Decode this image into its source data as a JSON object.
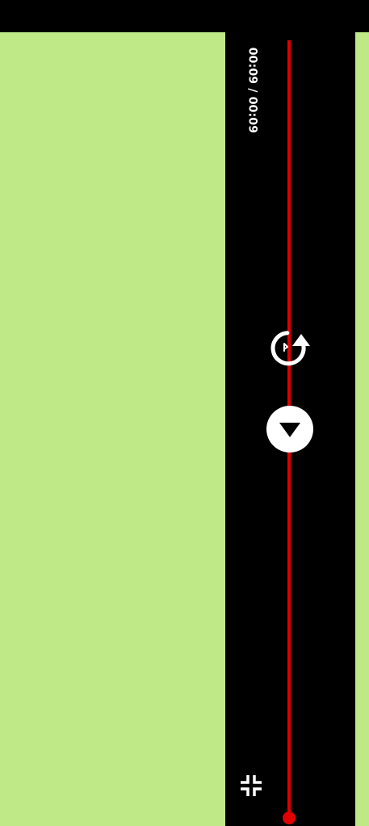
{
  "colors": {
    "background": "#000000",
    "content_green": "#bfe987",
    "seek_red": "#e10000",
    "icon_white": "#ffffff"
  },
  "player": {
    "time_current": "00:09",
    "time_separator": " / ",
    "time_total": "00:09",
    "progress": 1.0,
    "icons": {
      "replay": "replay-icon",
      "play": "play-icon",
      "exit_fullscreen": "fullscreen-exit-icon"
    }
  }
}
